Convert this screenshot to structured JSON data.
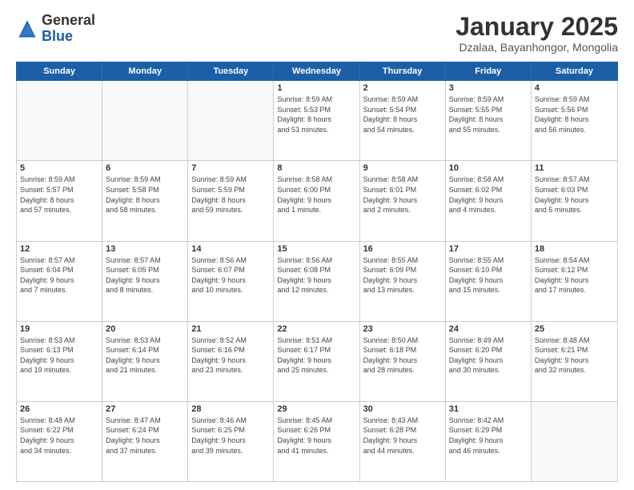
{
  "header": {
    "logo_general": "General",
    "logo_blue": "Blue",
    "month_title": "January 2025",
    "location": "Dzalaa, Bayanhongor, Mongolia"
  },
  "weekdays": [
    "Sunday",
    "Monday",
    "Tuesday",
    "Wednesday",
    "Thursday",
    "Friday",
    "Saturday"
  ],
  "rows": [
    [
      {
        "day": "",
        "text": ""
      },
      {
        "day": "",
        "text": ""
      },
      {
        "day": "",
        "text": ""
      },
      {
        "day": "1",
        "text": "Sunrise: 8:59 AM\nSunset: 5:53 PM\nDaylight: 8 hours\nand 53 minutes."
      },
      {
        "day": "2",
        "text": "Sunrise: 8:59 AM\nSunset: 5:54 PM\nDaylight: 8 hours\nand 54 minutes."
      },
      {
        "day": "3",
        "text": "Sunrise: 8:59 AM\nSunset: 5:55 PM\nDaylight: 8 hours\nand 55 minutes."
      },
      {
        "day": "4",
        "text": "Sunrise: 8:59 AM\nSunset: 5:56 PM\nDaylight: 8 hours\nand 56 minutes."
      }
    ],
    [
      {
        "day": "5",
        "text": "Sunrise: 8:59 AM\nSunset: 5:57 PM\nDaylight: 8 hours\nand 57 minutes."
      },
      {
        "day": "6",
        "text": "Sunrise: 8:59 AM\nSunset: 5:58 PM\nDaylight: 8 hours\nand 58 minutes."
      },
      {
        "day": "7",
        "text": "Sunrise: 8:59 AM\nSunset: 5:59 PM\nDaylight: 8 hours\nand 59 minutes."
      },
      {
        "day": "8",
        "text": "Sunrise: 8:58 AM\nSunset: 6:00 PM\nDaylight: 9 hours\nand 1 minute."
      },
      {
        "day": "9",
        "text": "Sunrise: 8:58 AM\nSunset: 6:01 PM\nDaylight: 9 hours\nand 2 minutes."
      },
      {
        "day": "10",
        "text": "Sunrise: 8:58 AM\nSunset: 6:02 PM\nDaylight: 9 hours\nand 4 minutes."
      },
      {
        "day": "11",
        "text": "Sunrise: 8:57 AM\nSunset: 6:03 PM\nDaylight: 9 hours\nand 5 minutes."
      }
    ],
    [
      {
        "day": "12",
        "text": "Sunrise: 8:57 AM\nSunset: 6:04 PM\nDaylight: 9 hours\nand 7 minutes."
      },
      {
        "day": "13",
        "text": "Sunrise: 8:57 AM\nSunset: 6:05 PM\nDaylight: 9 hours\nand 8 minutes."
      },
      {
        "day": "14",
        "text": "Sunrise: 8:56 AM\nSunset: 6:07 PM\nDaylight: 9 hours\nand 10 minutes."
      },
      {
        "day": "15",
        "text": "Sunrise: 8:56 AM\nSunset: 6:08 PM\nDaylight: 9 hours\nand 12 minutes."
      },
      {
        "day": "16",
        "text": "Sunrise: 8:55 AM\nSunset: 6:09 PM\nDaylight: 9 hours\nand 13 minutes."
      },
      {
        "day": "17",
        "text": "Sunrise: 8:55 AM\nSunset: 6:10 PM\nDaylight: 9 hours\nand 15 minutes."
      },
      {
        "day": "18",
        "text": "Sunrise: 8:54 AM\nSunset: 6:12 PM\nDaylight: 9 hours\nand 17 minutes."
      }
    ],
    [
      {
        "day": "19",
        "text": "Sunrise: 8:53 AM\nSunset: 6:13 PM\nDaylight: 9 hours\nand 19 minutes."
      },
      {
        "day": "20",
        "text": "Sunrise: 8:53 AM\nSunset: 6:14 PM\nDaylight: 9 hours\nand 21 minutes."
      },
      {
        "day": "21",
        "text": "Sunrise: 8:52 AM\nSunset: 6:16 PM\nDaylight: 9 hours\nand 23 minutes."
      },
      {
        "day": "22",
        "text": "Sunrise: 8:51 AM\nSunset: 6:17 PM\nDaylight: 9 hours\nand 25 minutes."
      },
      {
        "day": "23",
        "text": "Sunrise: 8:50 AM\nSunset: 6:18 PM\nDaylight: 9 hours\nand 28 minutes."
      },
      {
        "day": "24",
        "text": "Sunrise: 8:49 AM\nSunset: 6:20 PM\nDaylight: 9 hours\nand 30 minutes."
      },
      {
        "day": "25",
        "text": "Sunrise: 8:48 AM\nSunset: 6:21 PM\nDaylight: 9 hours\nand 32 minutes."
      }
    ],
    [
      {
        "day": "26",
        "text": "Sunrise: 8:48 AM\nSunset: 6:22 PM\nDaylight: 9 hours\nand 34 minutes."
      },
      {
        "day": "27",
        "text": "Sunrise: 8:47 AM\nSunset: 6:24 PM\nDaylight: 9 hours\nand 37 minutes."
      },
      {
        "day": "28",
        "text": "Sunrise: 8:46 AM\nSunset: 6:25 PM\nDaylight: 9 hours\nand 39 minutes."
      },
      {
        "day": "29",
        "text": "Sunrise: 8:45 AM\nSunset: 6:26 PM\nDaylight: 9 hours\nand 41 minutes."
      },
      {
        "day": "30",
        "text": "Sunrise: 8:43 AM\nSunset: 6:28 PM\nDaylight: 9 hours\nand 44 minutes."
      },
      {
        "day": "31",
        "text": "Sunrise: 8:42 AM\nSunset: 6:29 PM\nDaylight: 9 hours\nand 46 minutes."
      },
      {
        "day": "",
        "text": ""
      }
    ]
  ]
}
